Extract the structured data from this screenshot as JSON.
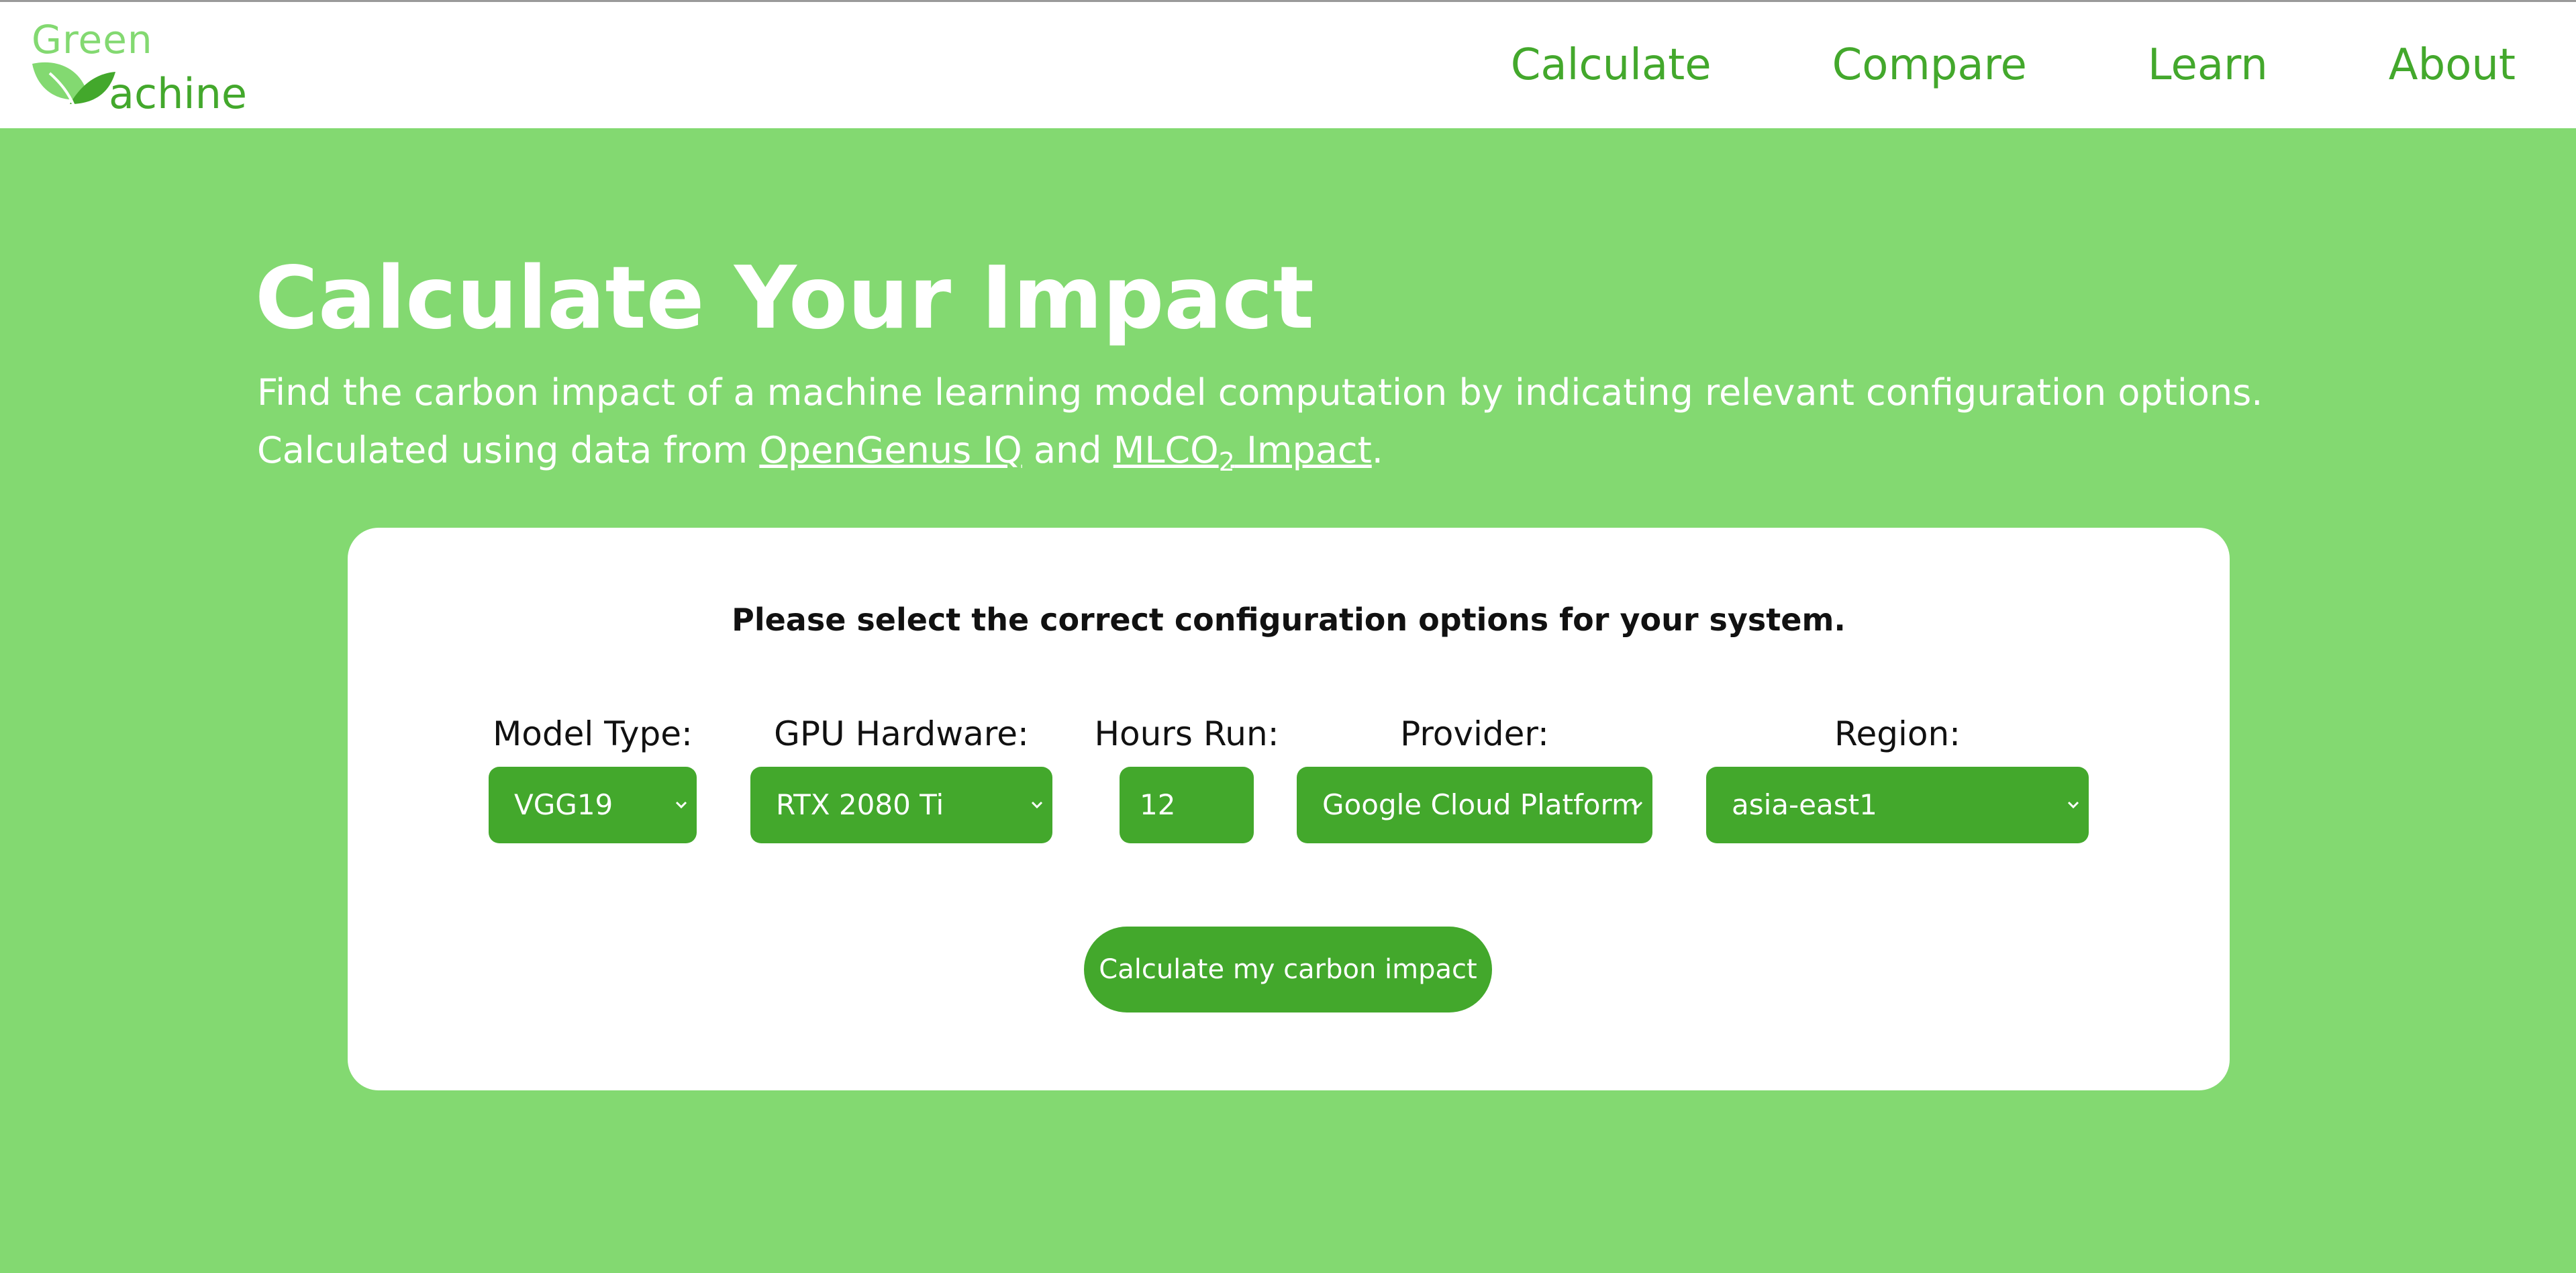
{
  "brand": {
    "line1": "Green",
    "line2": "achine"
  },
  "nav": {
    "items": [
      "Calculate",
      "Compare",
      "Learn",
      "About"
    ]
  },
  "hero": {
    "title": "Calculate Your Impact",
    "description": "Find the carbon impact of a machine learning model computation by indicating relevant configuration options.",
    "source_prefix": "Calculated using data from ",
    "source_link1": "OpenGenus IQ",
    "source_and": " and ",
    "source_link2_main": "MLCO",
    "source_link2_sub": "2",
    "source_link2_rest": " Impact",
    "source_suffix": "."
  },
  "form": {
    "instruction": "Please select the correct configuration options for your system.",
    "model_type": {
      "label": "Model Type:",
      "value": "VGG19"
    },
    "gpu_hardware": {
      "label": "GPU Hardware:",
      "value": "RTX 2080 Ti"
    },
    "hours_run": {
      "label": "Hours Run:",
      "value": "12"
    },
    "provider": {
      "label": "Provider:",
      "value": "Google Cloud Platform"
    },
    "region": {
      "label": "Region:",
      "value": "asia-east1"
    },
    "submit_label": "Calculate my carbon impact"
  },
  "colors": {
    "background": "#83d971",
    "accent": "#43a82c",
    "card": "#ffffff"
  }
}
